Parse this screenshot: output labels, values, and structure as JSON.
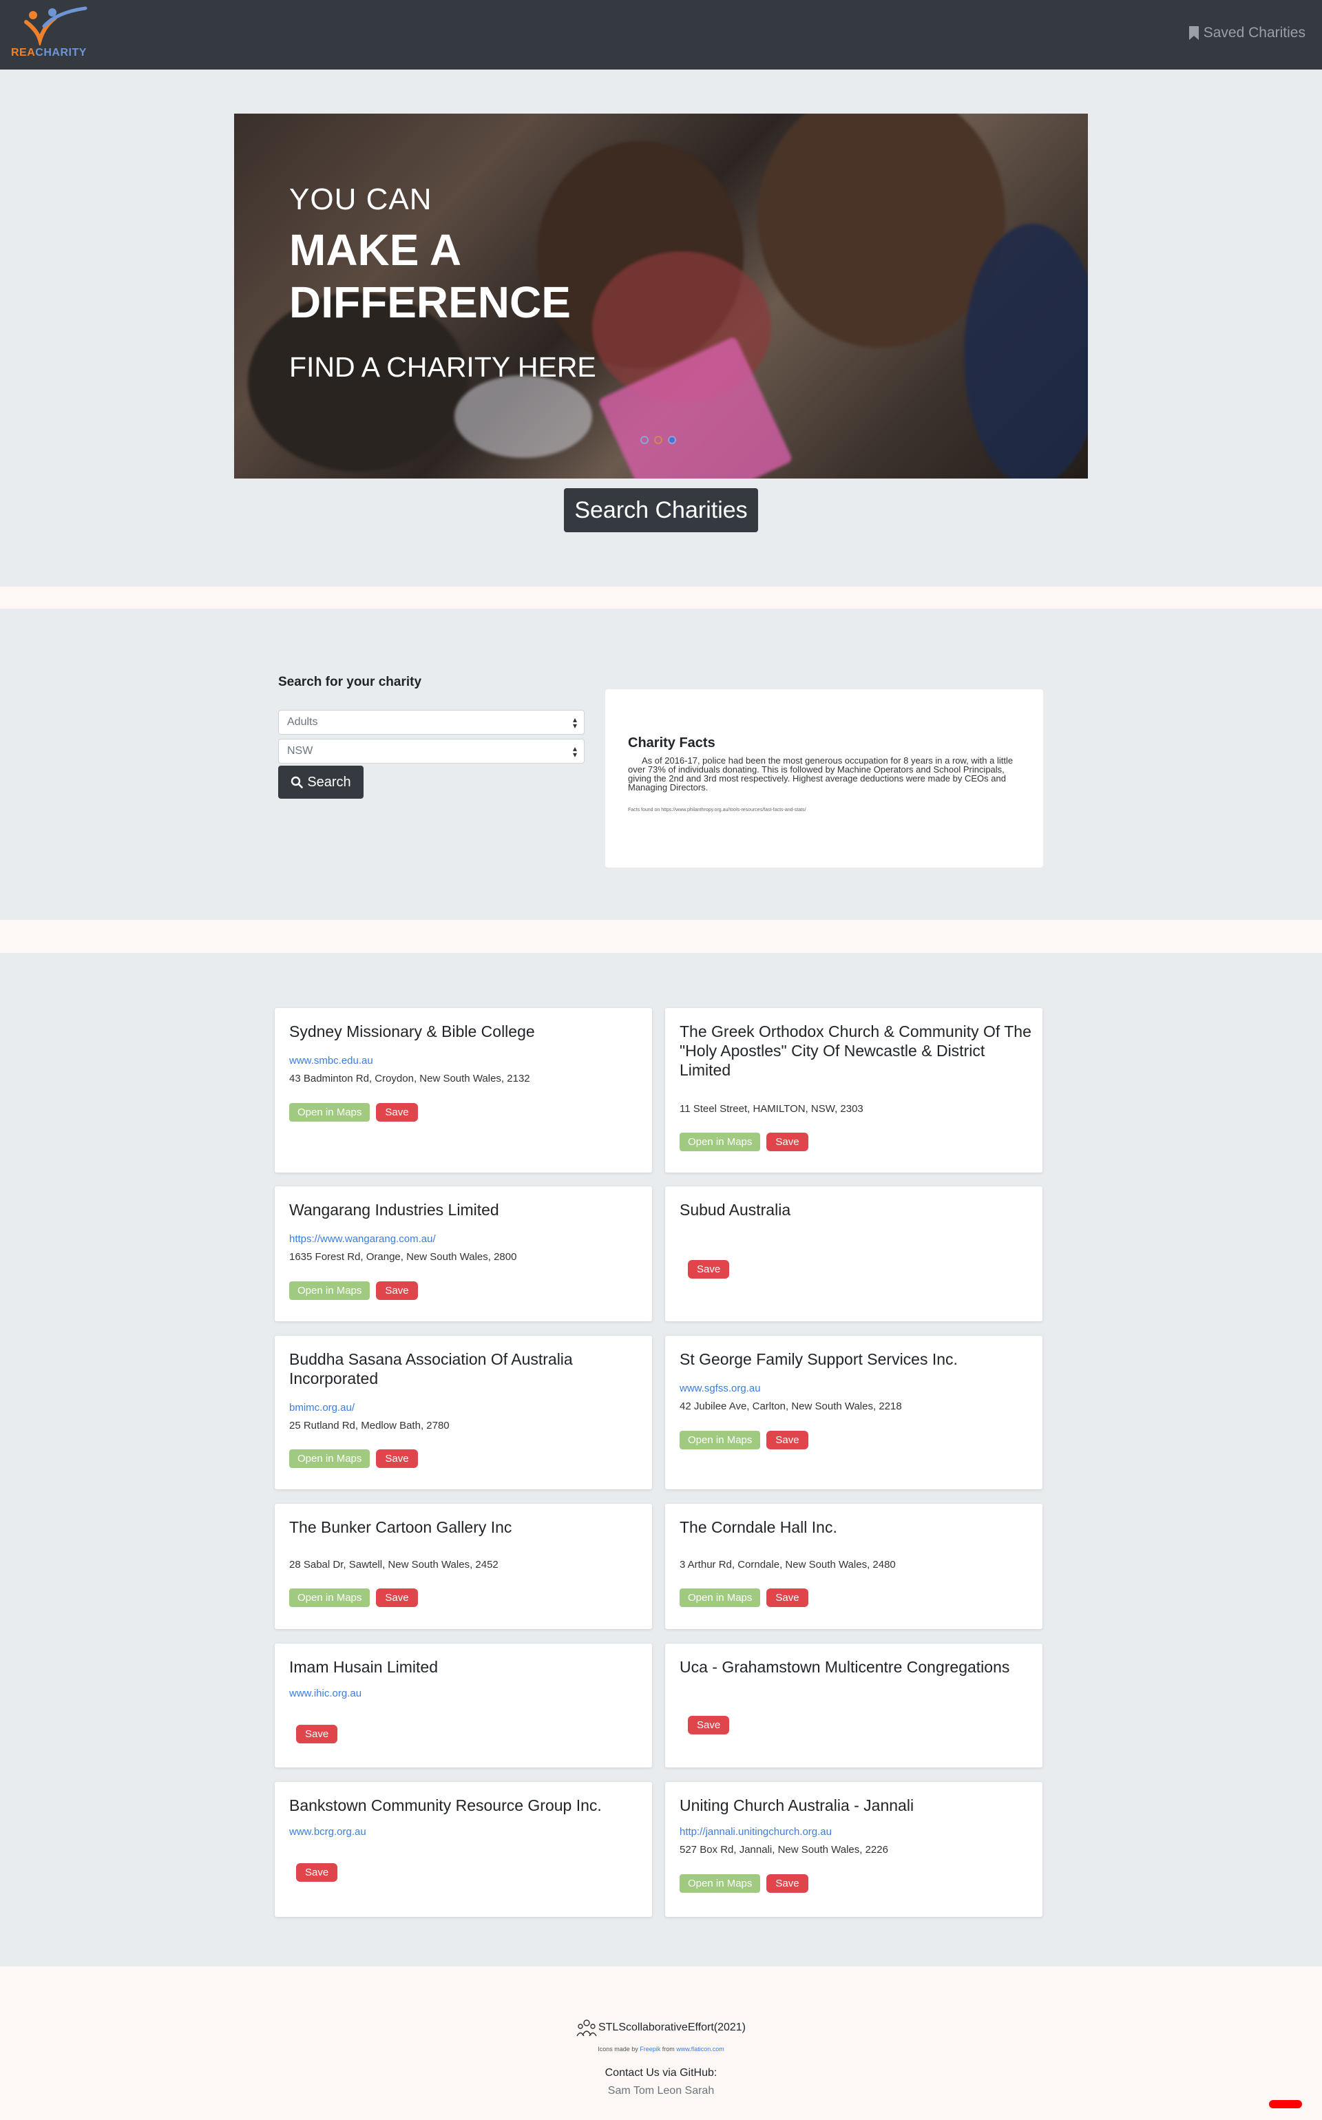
{
  "navbar": {
    "logo_rea": "REA",
    "logo_charity": "CHARITY",
    "saved_label": "Saved Charities"
  },
  "hero": {
    "line1": "YOU CAN",
    "line2a": "MAKE A",
    "line2b": "DIFFERENCE",
    "line3": "FIND A CHARITY HERE",
    "cta": "Search Charities"
  },
  "search": {
    "title": "Search for your charity",
    "category_selected": "Adults",
    "state_selected": "NSW",
    "button": "Search"
  },
  "facts": {
    "title": "Charity Facts",
    "body": "As of 2016-17, police had been the most generous occupation for 8 years in a row, with a little over 73% of individuals donating. This is followed by Machine Operators and School Principals, giving the 2nd and 3rd most respectively. Highest average deductions were made by CEOs and Managing Directors.",
    "source": "Facts found on https://www.philanthropy.org.au/tools-resources/fast-facts-and-stats/"
  },
  "labels": {
    "maps": "Open in Maps",
    "save": "Save"
  },
  "results": [
    {
      "title": "Sydney Missionary & Bible College",
      "link": "www.smbc.edu.au",
      "address": "43 Badminton Rd, Croydon, New South Wales, 2132"
    },
    {
      "title": "The Greek Orthodox Church & Community Of The \"Holy Apostles\" City Of Newcastle & District Limited",
      "link": "",
      "address": "11 Steel Street, HAMILTON, NSW, 2303"
    },
    {
      "title": "Wangarang Industries Limited",
      "link": "https://www.wangarang.com.au/",
      "address": "1635 Forest Rd, Orange, New South Wales, 2800"
    },
    {
      "title": "Subud Australia",
      "link": "",
      "address": ""
    },
    {
      "title": "Buddha Sasana Association Of Australia Incorporated",
      "link": "bmimc.org.au/",
      "address": "25 Rutland Rd, Medlow Bath, 2780"
    },
    {
      "title": "St George Family Support Services Inc.",
      "link": "www.sgfss.org.au",
      "address": "42 Jubilee Ave, Carlton, New South Wales, 2218"
    },
    {
      "title": "The Bunker Cartoon Gallery Inc",
      "link": "",
      "address": "28 Sabal Dr, Sawtell, New South Wales, 2452"
    },
    {
      "title": "The Corndale Hall Inc.",
      "link": "",
      "address": "3 Arthur Rd, Corndale, New South Wales, 2480"
    },
    {
      "title": "Imam Husain Limited",
      "link": "www.ihic.org.au",
      "address": ""
    },
    {
      "title": "Uca - Grahamstown Multicentre Congregations",
      "link": "",
      "address": ""
    },
    {
      "title": "Bankstown Community Resource Group Inc.",
      "link": "www.bcrg.org.au",
      "address": ""
    },
    {
      "title": "Uniting Church Australia - Jannali",
      "link": "http://jannali.unitingchurch.org.au",
      "address": "527 Box Rd, Jannali, New South Wales, 2226"
    }
  ],
  "footer": {
    "brand": "STLScollaborativeEffort(2021)",
    "icons_pre": "Icons made by",
    "icons_author": "Freepik",
    "icons_mid": "from",
    "icons_site": "www.flaticon.com",
    "contact": "Contact Us via GitHub:",
    "names": "Sam Tom Leon Sarah"
  }
}
